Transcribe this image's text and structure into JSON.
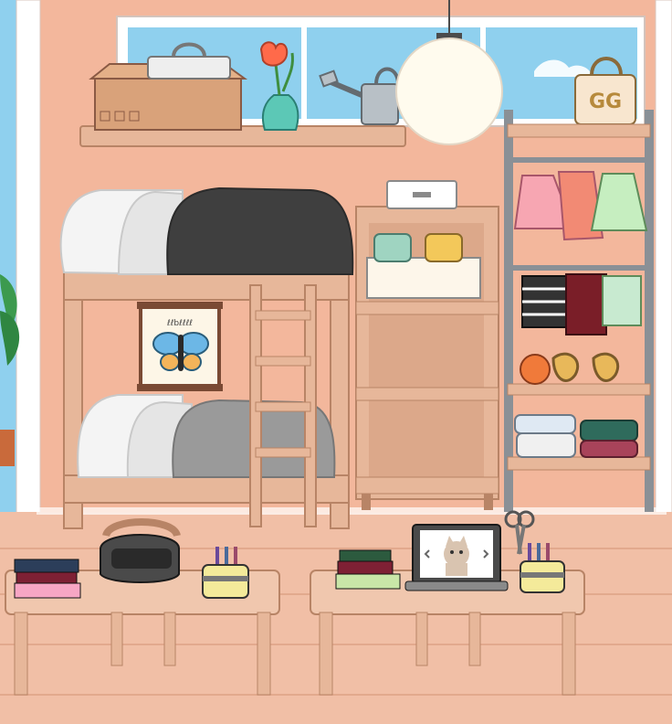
{
  "scene": {
    "room": "bedroom",
    "items": [
      {
        "id": "storage-box",
        "icon": "cardboard-box-icon"
      },
      {
        "id": "tote-bag",
        "icon": "bag-icon"
      },
      {
        "id": "tulip-vase",
        "icon": "flower-vase-icon"
      },
      {
        "id": "watering-can",
        "icon": "watering-can-icon"
      },
      {
        "id": "pendant-lamp",
        "icon": "lamp-icon"
      },
      {
        "id": "handbag",
        "icon": "handbag-icon"
      },
      {
        "id": "bunk-bed",
        "icon": "bed-icon"
      },
      {
        "id": "butterfly-poster",
        "icon": "butterfly-icon"
      },
      {
        "id": "ladder",
        "icon": "ladder-icon"
      },
      {
        "id": "cabinet",
        "icon": "shelf-icon"
      },
      {
        "id": "clothing-rack",
        "icon": "clothes-rack-icon"
      },
      {
        "id": "desk-left",
        "icon": "table-icon"
      },
      {
        "id": "desk-right",
        "icon": "table-icon"
      },
      {
        "id": "laptop",
        "icon": "laptop-icon"
      },
      {
        "id": "helmet",
        "icon": "helmet-icon"
      }
    ]
  },
  "laptop": {
    "screen_content": "cat-photo",
    "nav_prev_icon": "chevron-left-icon",
    "nav_next_icon": "chevron-right-icon"
  },
  "colors": {
    "wall": "#f3b79c",
    "floor": "#f1bfa6",
    "wood": "#e7b79a",
    "wood_dark": "#b88466",
    "outline": "#8a5a44",
    "window_sky": "#8fd0ee",
    "lamp": "#fffbee",
    "tulip": "#ff6a4a"
  },
  "poster": {
    "caption": "ℓℓbℓℓℓℓ"
  }
}
